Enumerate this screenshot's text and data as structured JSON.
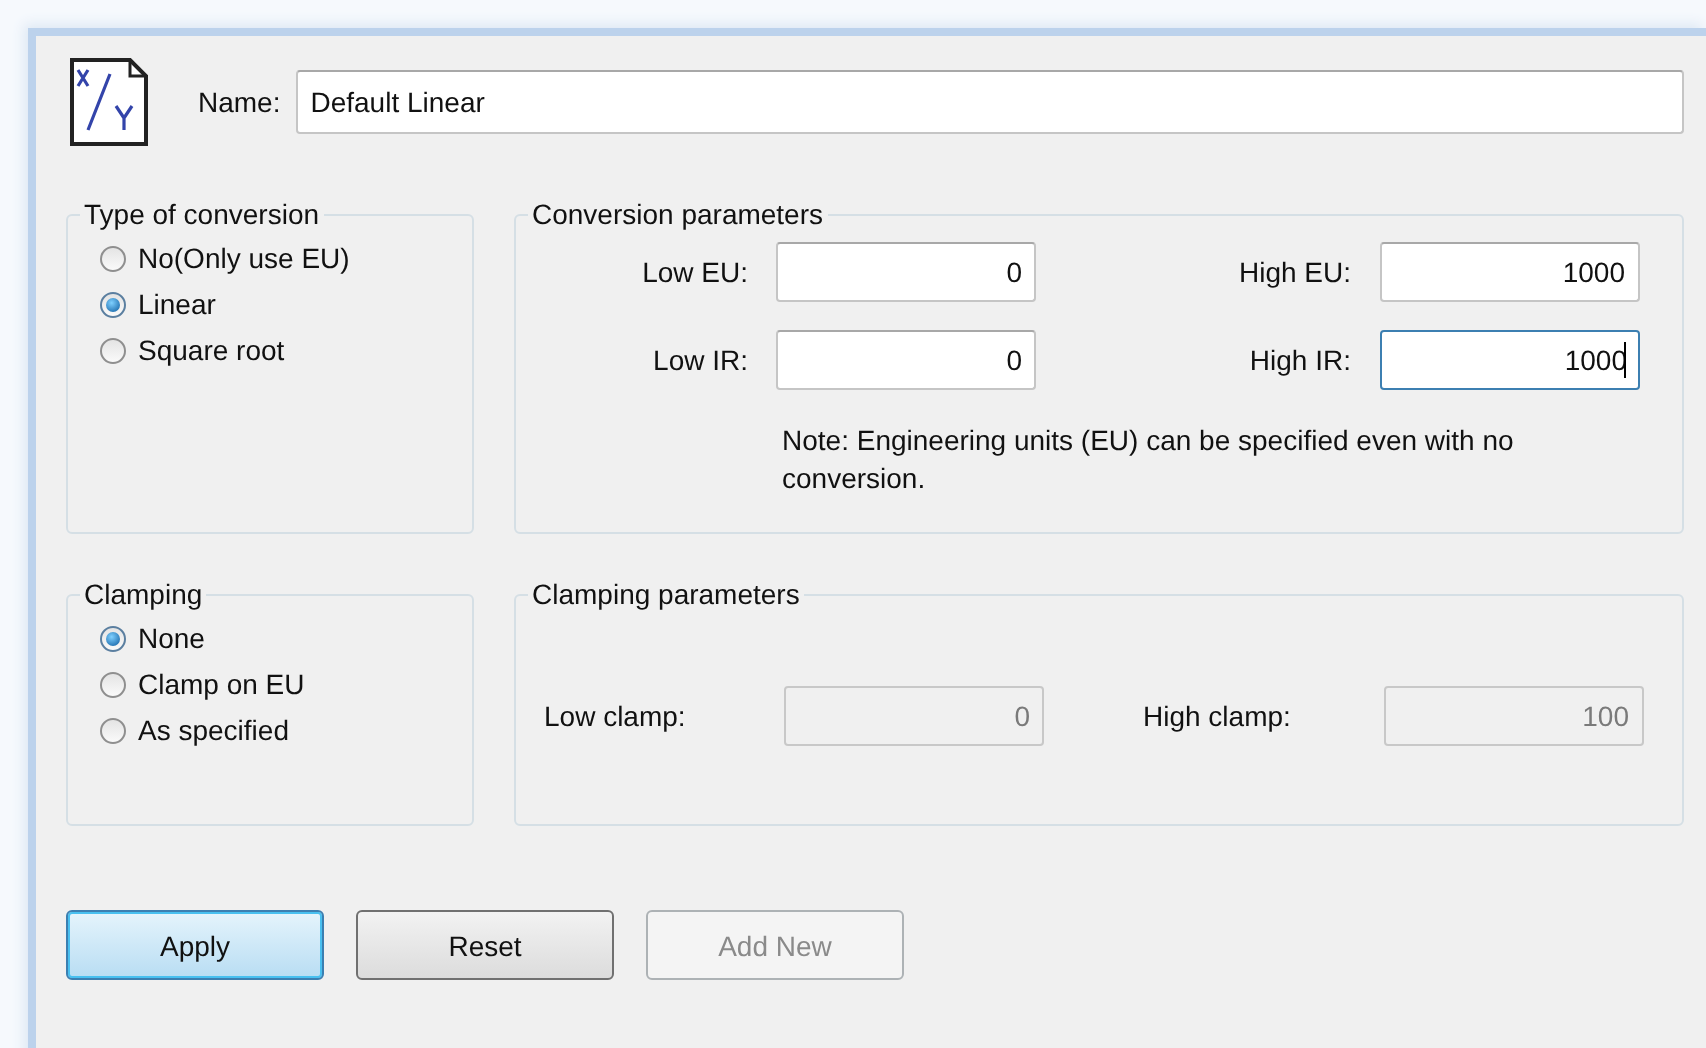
{
  "name_field": {
    "label": "Name:",
    "value": "Default Linear"
  },
  "conversion_type": {
    "title": "Type of conversion",
    "options": [
      {
        "label": "No(Only use EU)",
        "selected": false
      },
      {
        "label": "Linear",
        "selected": true
      },
      {
        "label": "Square root",
        "selected": false
      }
    ]
  },
  "conversion_parameters": {
    "title": "Conversion parameters",
    "fields": [
      {
        "label": "Low EU:",
        "value": "0",
        "disabled": false,
        "focused": false
      },
      {
        "label": "High EU:",
        "value": "1000",
        "disabled": false,
        "focused": false
      },
      {
        "label": "Low IR:",
        "value": "0",
        "disabled": false,
        "focused": false
      },
      {
        "label": "High IR:",
        "value": "1000",
        "disabled": false,
        "focused": true
      }
    ],
    "note": "Note: Engineering units (EU) can be specified even with no conversion."
  },
  "clamping": {
    "title": "Clamping",
    "options": [
      {
        "label": "None",
        "selected": true
      },
      {
        "label": "Clamp on EU",
        "selected": false
      },
      {
        "label": "As specified",
        "selected": false
      }
    ]
  },
  "clamping_parameters": {
    "title": "Clamping parameters",
    "fields": [
      {
        "label": "Low clamp:",
        "value": "0",
        "disabled": true,
        "focused": false
      },
      {
        "label": "High clamp:",
        "value": "100",
        "disabled": true,
        "focused": false
      }
    ]
  },
  "buttons": [
    {
      "label": "Apply",
      "kind": "default",
      "disabled": false
    },
    {
      "label": "Reset",
      "kind": "normal",
      "disabled": false
    },
    {
      "label": "Add New",
      "kind": "normal",
      "disabled": true
    }
  ]
}
